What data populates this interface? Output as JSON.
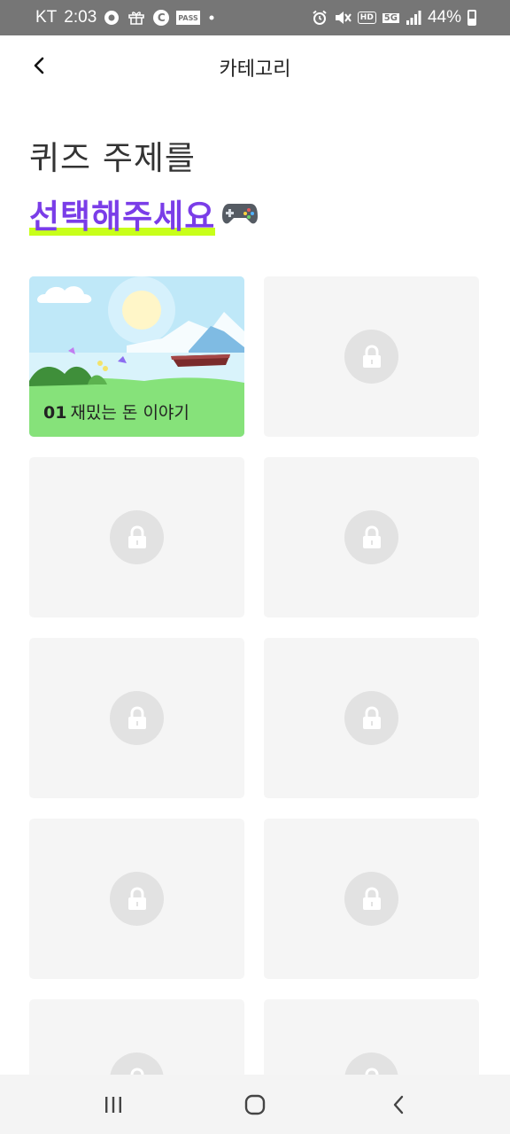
{
  "status_bar": {
    "carrier": "KT",
    "time": "2:03",
    "left_icons": [
      "circle-dot-icon",
      "gift-icon",
      "c-circle-icon",
      "pass-icon",
      "dot-icon"
    ],
    "pass_text": "PASS",
    "c_text": "C",
    "right_icons": [
      "alarm-icon",
      "mute-icon",
      "hd-icon",
      "5g-icon",
      "signal-icon"
    ],
    "hd_text": "HD",
    "network_text": "5G",
    "battery": "44%",
    "background_color": "#767676"
  },
  "header": {
    "title": "카테고리",
    "back_icon": "chevron-left-icon"
  },
  "headline": {
    "line1": "퀴즈 주제를",
    "line2": "선택해주세요",
    "emoji_icon": "gamepad-icon",
    "accent_color": "#7a3de8",
    "highlight_color": "#c8ff1a"
  },
  "categories": [
    {
      "number": "01",
      "title": "재밌는 돈 이야기",
      "locked": false
    },
    {
      "locked": true
    },
    {
      "locked": true
    },
    {
      "locked": true
    },
    {
      "locked": true
    },
    {
      "locked": true
    },
    {
      "locked": true
    },
    {
      "locked": true
    },
    {
      "locked": true
    },
    {
      "locked": true
    }
  ],
  "nav_bar": {
    "buttons": [
      "recent-apps-icon",
      "home-icon",
      "back-icon"
    ]
  }
}
